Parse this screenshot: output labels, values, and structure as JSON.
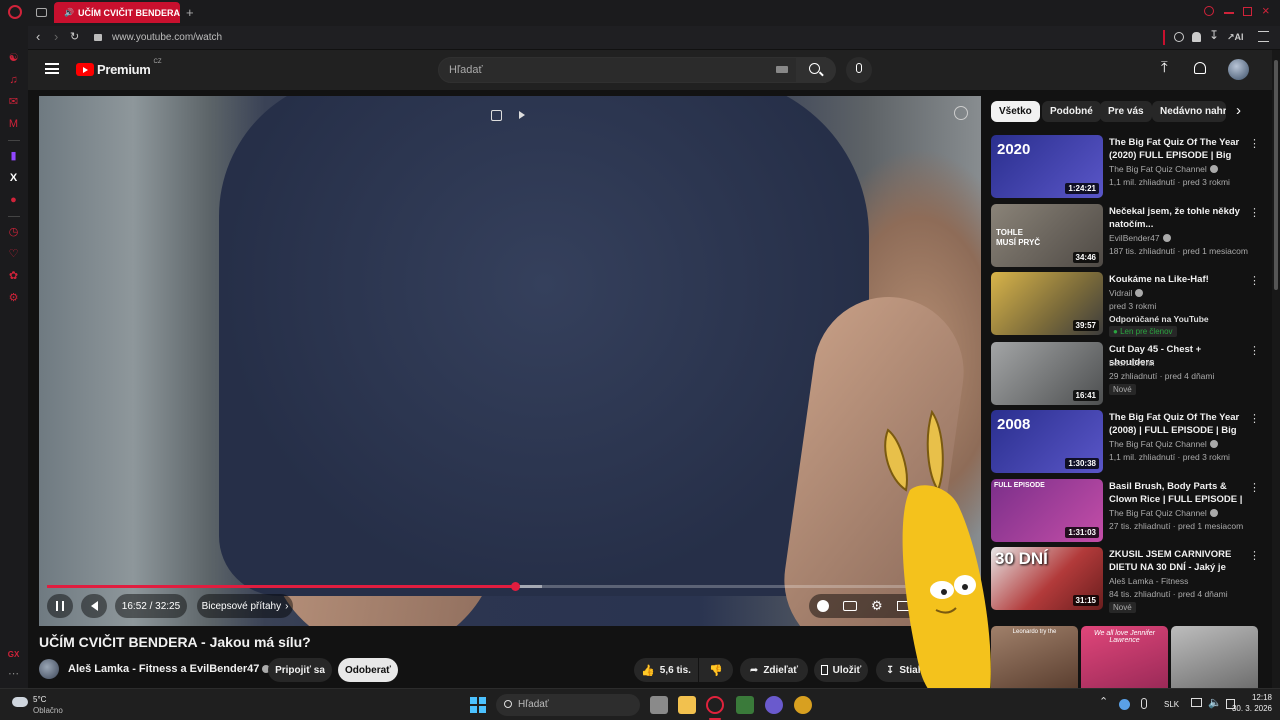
{
  "browser": {
    "tab_title": "UČÍM CVIČIT BENDERA",
    "url": "www.youtube.com/watch",
    "ai_label": "AI"
  },
  "youtube": {
    "logo_text": "Premium",
    "logo_region": "CZ",
    "search_placeholder": "Hľadať"
  },
  "player": {
    "time": "16:52 / 32:25",
    "chapter": "Bicepsové přítahy",
    "progress_fraction": 0.52,
    "buffered_fraction": 0.55
  },
  "video": {
    "title": "UČÍM CVIČIT BENDERA - Jakou má sílu?",
    "channel": "Aleš Lamka - Fitness a EvilBender47",
    "join_label": "Pripojiť sa",
    "subscribe_label": "Odoberať",
    "likes": "5,6 tis.",
    "share_label": "Zdieľať",
    "save_label": "Uložiť",
    "download_label": "Stiahnuť"
  },
  "chips": [
    "Všetko",
    "Podobné",
    "Pre vás",
    "Nedávno nahra"
  ],
  "recommendations": [
    {
      "title": "The Big Fat Quiz Of The Year (2020) FULL EPISODE | Big Fat...",
      "channel": "The Big Fat Quiz Channel",
      "meta": "1,1 mil. zhliadnutí · pred 3 rokmi",
      "duration": "1:24:21",
      "thumb_color": "#3b3f9e",
      "thumb_text": "2020"
    },
    {
      "title": "Nečekal jsem, že tohle někdy natočím...",
      "channel": "EvilBender47",
      "meta": "187 tis. zhliadnutí · pred 1 mesiacom",
      "duration": "34:46",
      "thumb_color": "#6f6a62",
      "thumb_text": "TOHLE MUSÍ PRYČ"
    },
    {
      "title": "Koukáme na Like-Haf!",
      "channel": "Vidrail",
      "meta": "pred 3 rokmi",
      "extra": "Odporúčané na YouTube",
      "badge": "Len pre členov",
      "duration": "39:57",
      "thumb_color": "#c9a13a",
      "thumb_text": ""
    },
    {
      "title": "Cut Day 45 - Chest + shoulders",
      "channel": "Leon Cvenk",
      "meta": "29 zhliadnutí · pred 4 dňami",
      "tag": "Nové",
      "duration": "16:41",
      "thumb_color": "#7d7f80",
      "thumb_text": ""
    },
    {
      "title": "The Big Fat Quiz Of The Year (2008) | FULL EPISODE | Big F...",
      "channel": "The Big Fat Quiz Channel",
      "meta": "1,1 mil. zhliadnutí · pred 3 rokmi",
      "duration": "1:30:38",
      "thumb_color": "#3a3e9a",
      "thumb_text": "2008"
    },
    {
      "title": "Basil Brush, Body Parts & Clown Rice | FULL EPISODE | Big Fat ...",
      "channel": "The Big Fat Quiz Channel",
      "meta": "27 tis. zhliadnutí · pred 1 mesiacom",
      "duration": "1:31:03",
      "thumb_color": "#7b2f8a",
      "thumb_text": "FULL EPISODE"
    },
    {
      "title": "ZKUSIL JSEM CARNIVORE DIETU NA 30 DNÍ - Jaký je můj...",
      "channel": "Aleš Lamka - Fitness",
      "meta": "84 tis. zhliadnutí · pred 4 dňami",
      "tag": "Nové",
      "duration": "31:15",
      "thumb_color": "#b23a3a",
      "thumb_text": "30 DNÍ"
    }
  ],
  "shorts": [
    {
      "caption": "Leonardo try the",
      "color": "#6b4b3a"
    },
    {
      "caption": "We all love Jennifer Lawrence",
      "color": "#d23a6a"
    },
    {
      "caption": "",
      "color": "#8a8a8a"
    }
  ],
  "taskbar": {
    "weather_temp": "5°C",
    "weather_desc": "Oblačno",
    "search_placeholder": "Hľadať",
    "language": "SLK",
    "time": "12:18",
    "date": "30. 3. 2026"
  },
  "colors": {
    "opera_red": "#c8102e",
    "yt_red": "#ff0000",
    "progress": "#e11d3f"
  }
}
